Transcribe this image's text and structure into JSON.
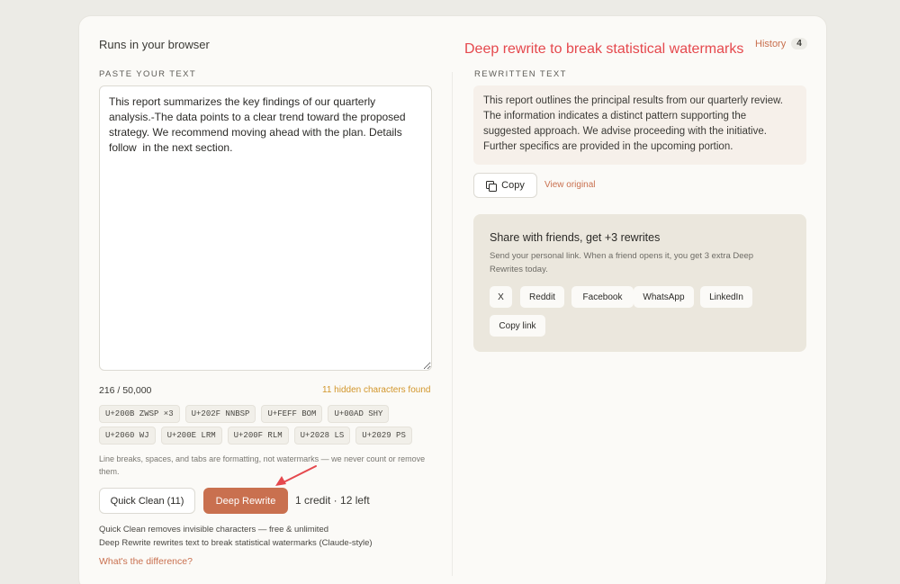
{
  "header": {
    "runs_label": "Runs in your browser",
    "annotation_title": "Deep rewrite to break statistical watermarks",
    "history_label": "History",
    "history_count": "4"
  },
  "input": {
    "section_label": "PASTE YOUR TEXT",
    "text": "This report summarizes the key findings of our quarterly analysis.-The data points to a clear trend toward the proposed strategy. We recommend moving ahead with the plan. Details follow  in the next section.",
    "char_count": "216 / 50,000",
    "hidden_found": "11 hidden characters found"
  },
  "hidden_chips_row1": [
    "U+200B ZWSP ×3",
    "U+202F NNBSP",
    "U+FEFF BOM",
    "U+00AD SHY"
  ],
  "hidden_chips_row2": [
    "U+2060 WJ",
    "U+200E LRM",
    "U+200F RLM",
    "U+2028 LS",
    "U+2029 PS"
  ],
  "formatting_note": "Line breaks, spaces, and tabs are formatting, not watermarks — we never count or remove them.",
  "actions": {
    "quick_clean_label": "Quick Clean (11)",
    "deep_rewrite_label": "Deep Rewrite",
    "credits_text": "1 credit · 12 left",
    "explain_line1": "Quick Clean removes invisible characters — free & unlimited",
    "explain_line2": "Deep Rewrite rewrites text to break statistical watermarks (Claude-style)",
    "difference_link": "What's the difference?"
  },
  "output": {
    "section_label": "REWRITTEN TEXT",
    "text": "This report outlines the principal results from our quarterly review. The information indicates a distinct pattern supporting the suggested approach. We advise proceeding with the initiative. Further specifics are provided in the upcoming portion.",
    "copy_label": "Copy",
    "view_original_label": "View original"
  },
  "share": {
    "title": "Share with friends, get +3 rewrites",
    "description": "Send your personal link. When a friend opens it, you get 3 extra Deep Rewrites today.",
    "buttons": {
      "x": "X",
      "reddit": "Reddit",
      "facebook": "Facebook",
      "whatsapp": "WhatsApp",
      "linkedin": "LinkedIn",
      "copy_link": "Copy link"
    }
  },
  "colors": {
    "accent": "#c9704f",
    "annotation": "#e5484d",
    "warning": "#d2962b"
  },
  "icons": [
    "copy-icon",
    "annotation-arrow"
  ]
}
